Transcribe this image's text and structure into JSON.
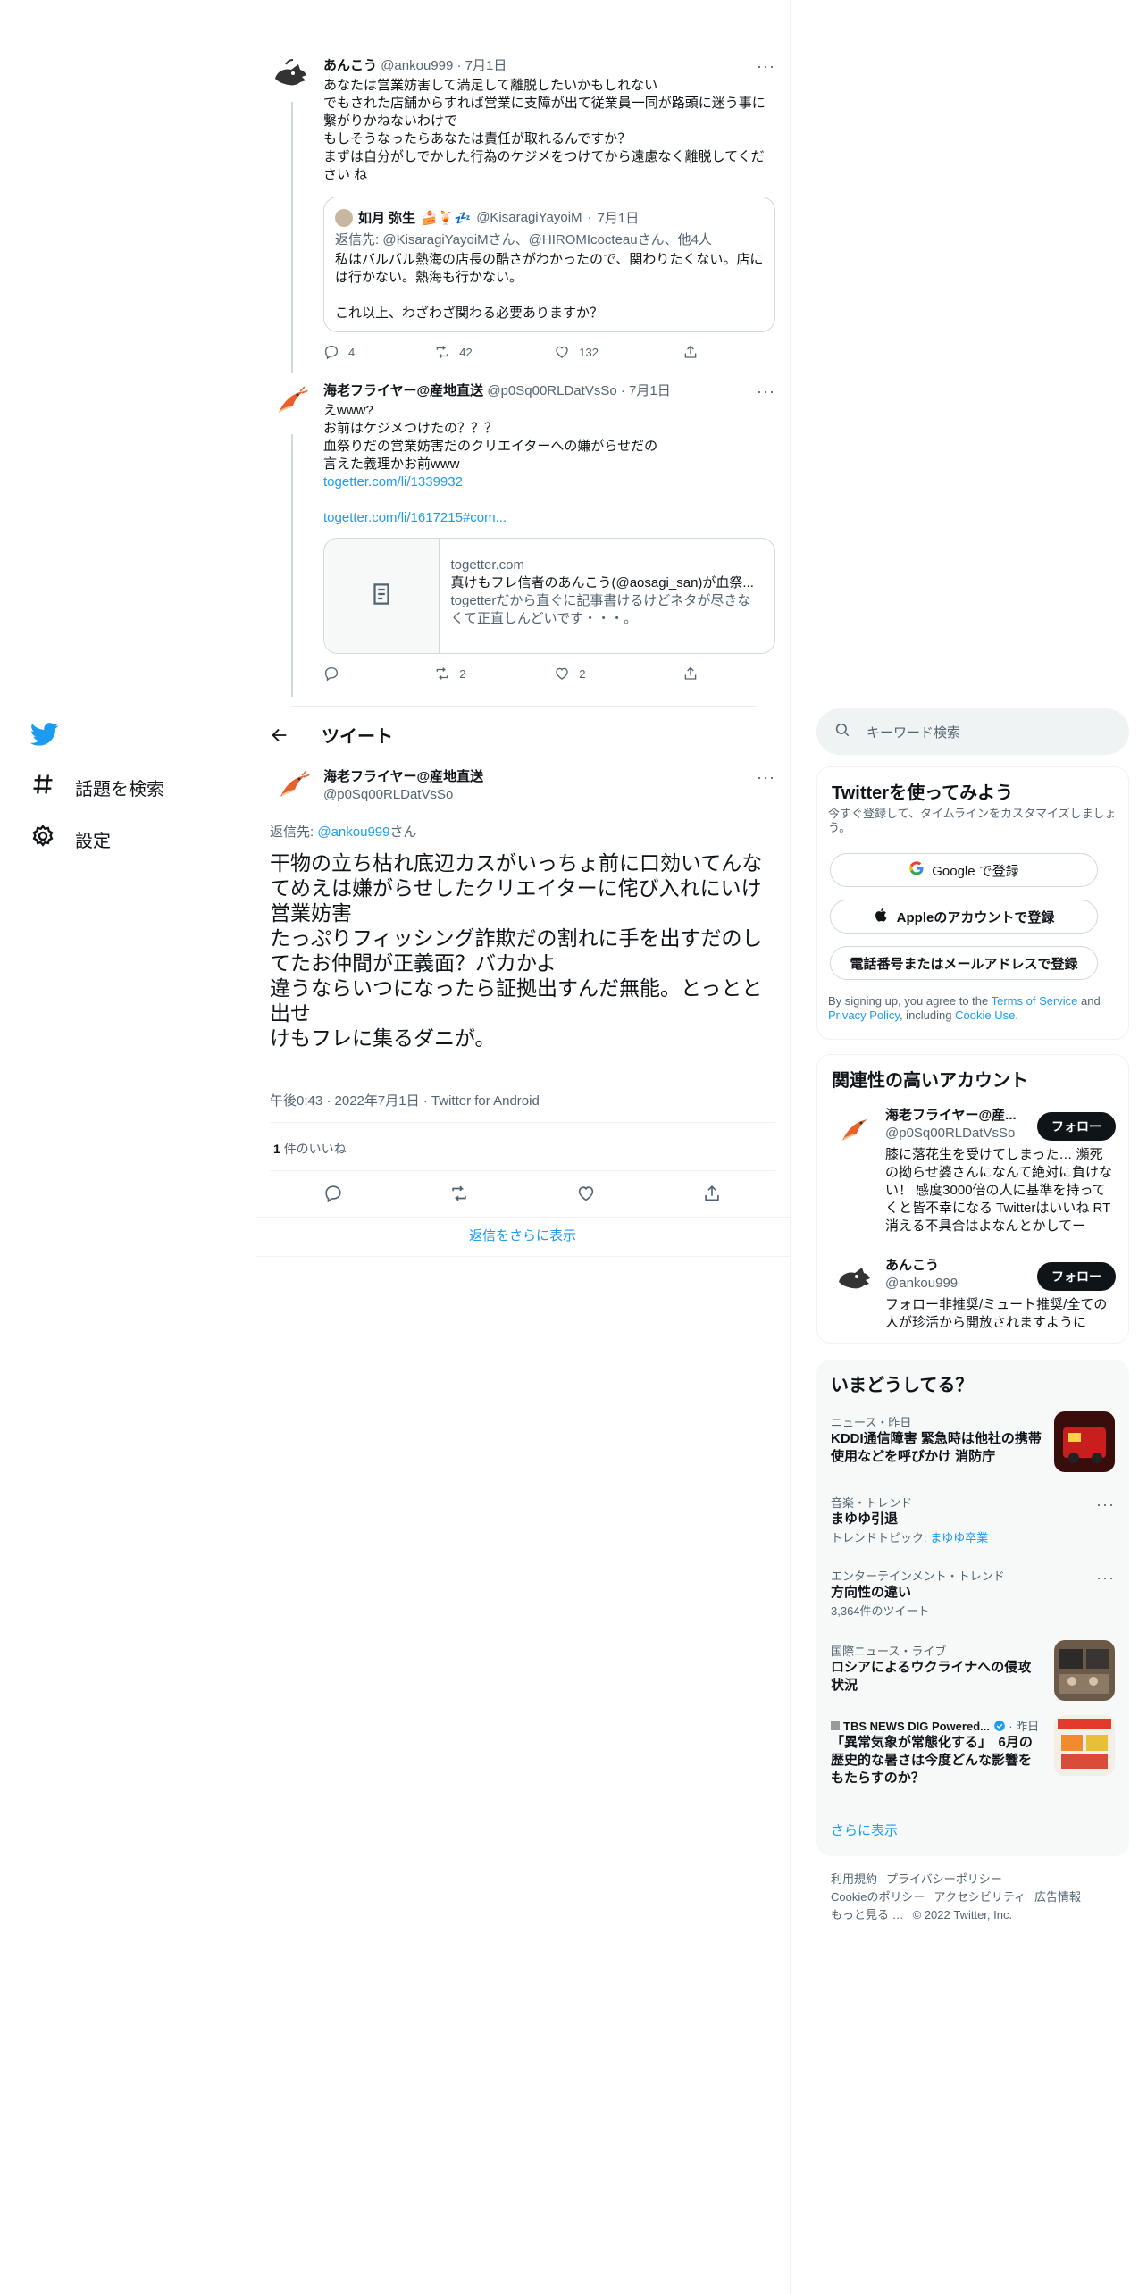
{
  "nav": {
    "explore_label": "話題を検索",
    "settings_label": "設定"
  },
  "header": {
    "title": "ツイート"
  },
  "thread": [
    {
      "name": "あんこう",
      "handle": "@ankou999",
      "date": "7月1日",
      "text": "あなたは営業妨害して満足して離脱したいかもしれない\nでもされた店舗からすれば営業に支障が出て従業員一同が路頭に迷う事に繋がりかねないわけで\nもしそうなったらあなたは責任が取れるんですか？\nまずは自分がしでかした行為のケジメをつけてから遠慮なく離脱してください ね",
      "quote": {
        "name": "如月 弥生",
        "handle": "@KisaragiYayoiM",
        "date": "7月1日",
        "reply_prefix": "返信先: ",
        "reply_to": "@KisaragiYayoiMさん、@HIROMIcocteauさん、他4人",
        "text": "私はバルバル熱海の店長の酷さがわかったので、関わりたくない。店には行かない。熱海も行かない。\n\nこれ以上、わざわざ関わる必要ありますか？"
      },
      "replies": "4",
      "retweets": "42",
      "likes": "132"
    },
    {
      "name": "海老フライヤー@産地直送",
      "handle": "@p0Sq00RLDatVsSo",
      "date": "7月1日",
      "text": "えwww?\nお前はケジメつけたの？？？\n血祭りだの営業妨害だのクリエイターへの嫌がらせだの\n言えた義理かお前www",
      "link1": "togetter.com/li/1339932",
      "link2": "togetter.com/li/1617215#com...",
      "card": {
        "domain": "togetter.com",
        "title": "真けもフレ信者のあんこう(@aosagi_san)が血祭...",
        "desc": "togetterだから直ぐに記事書けるけどネタが尽きなくて正直しんどいです・・・。"
      },
      "replies": "",
      "retweets": "2",
      "likes": "2"
    }
  ],
  "main_tweet": {
    "name": "海老フライヤー@産地直送",
    "handle": "@p0Sq00RLDatVsSo",
    "reply_prefix": "返信先: ",
    "reply_to": "@ankou999",
    "reply_suffix": "さん",
    "text": "干物の立ち枯れ底辺カスがいっちょ前に口効いてんな\nてめえは嫌がらせしたクリエイターに侘び入れにいけ営業妨害\nたっぷりフィッシング詐欺だの割れに手を出すだのしてたお仲間が正義面？バカかよ\n違うならいつになったら証拠出すんだ無能。とっとと出せ\nけもフレに集るダニが。",
    "meta": "午後0:43 · 2022年7月1日 · Twitter for Android",
    "likes_count": "1",
    "likes_label": "件のいいね",
    "show_more_replies": "返信をさらに表示"
  },
  "sidebar": {
    "search_placeholder": "キーワード検索",
    "signup": {
      "title": "Twitterを使ってみよう",
      "subtitle": "今すぐ登録して、タイムラインをカスタマイズしましょう。",
      "google_label": "Google で登録",
      "apple_label": "Appleのアカウントで登録",
      "phone_label": "電話番号またはメールアドレスで登録",
      "legal_prefix": "By signing up, you agree to the ",
      "tos": "Terms of Service",
      "and": " and ",
      "privacy": "Privacy Policy",
      "including": ", including ",
      "cookie": "Cookie Use",
      "end": "."
    },
    "related": {
      "title": "関連性の高いアカウント",
      "accounts": [
        {
          "name": "海老フライヤー@産...",
          "handle": "@p0Sq00RLDatVsSo",
          "follow": "フォロー",
          "bio": "膝に落花生を受けてしまった… 瀕死の拗らせ婆さんになんて絶対に負けない！ 感度3000倍の人に基準を持ってくと皆不幸になる Twitterはいいね RT消える不具合はよなんとかしてー"
        },
        {
          "name": "あんこう",
          "handle": "@ankou999",
          "follow": "フォロー",
          "bio": "フォロー非推奨/ミュート推奨/全ての人が珍活から開放されますように"
        }
      ]
    },
    "trends": {
      "title": "いまどうしてる？",
      "items": [
        {
          "meta": "ニュース・昨日",
          "title": "KDDI通信障害 緊急時は他社の携帯使用などを呼びかけ 消防庁"
        },
        {
          "meta": "音楽・トレンド",
          "title": "まゆゆ引退",
          "sub_prefix": "トレンドトピック: ",
          "sub_link": "まゆゆ卒業"
        },
        {
          "meta": "エンターテインメント・トレンド",
          "title": "方向性の違い",
          "sub": "3,364件のツイート"
        },
        {
          "meta": "国際ニュース・ライブ",
          "title": "ロシアによるウクライナへの侵攻状況"
        },
        {
          "meta_source": "TBS NEWS DIG Powered...",
          "meta_time": " · 昨日",
          "title": "「異常気象が常態化する」　6月の歴史的な暑さは今度どんな影響をもたらすのか？"
        }
      ],
      "show_more": "さらに表示"
    },
    "footer": {
      "links": [
        "利用規約",
        "プライバシーポリシー",
        "Cookieのポリシー",
        "アクセシビリティ",
        "広告情報",
        "もっと見る …"
      ],
      "copyright": "© 2022 Twitter, Inc."
    }
  },
  "colors": {
    "accent": "#1d9bf0",
    "text": "#0f1419",
    "muted": "#536471",
    "border": "#cfd9de"
  }
}
